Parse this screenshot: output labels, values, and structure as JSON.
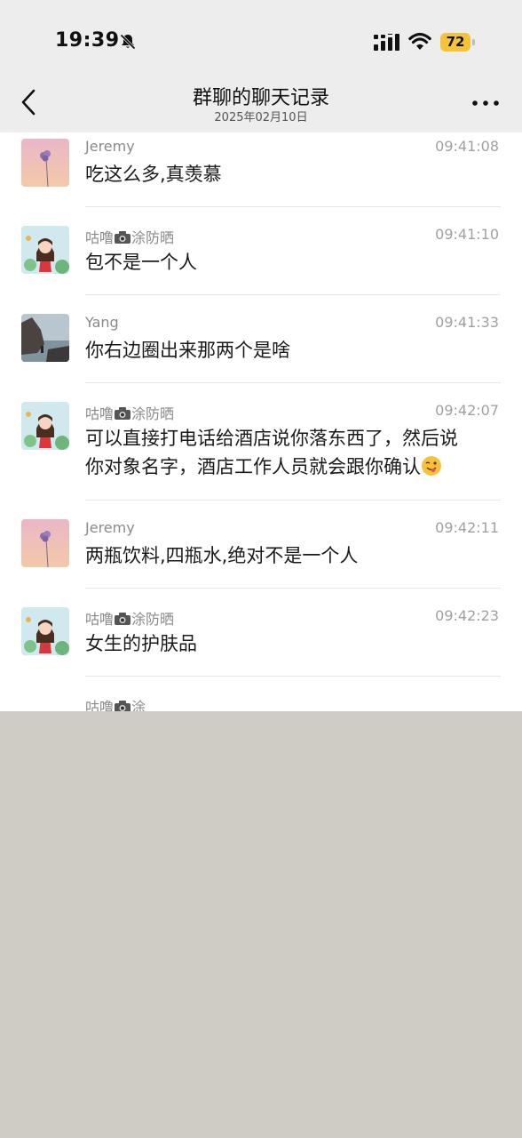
{
  "status_bar": {
    "time": "19:39",
    "battery": "72",
    "icons": [
      "bell-off-icon",
      "signal-icon",
      "wifi-icon",
      "battery-icon"
    ]
  },
  "header": {
    "title": "群聊的聊天记录",
    "subtitle": "2025年02月10日",
    "back_icon": "chevron-left-icon",
    "more_icon": "more-dots-icon"
  },
  "messages": [
    {
      "sender": "Jeremy",
      "time": "09:41:08",
      "text": "吃这么多,真羡慕",
      "avatar": "flower-avatar"
    },
    {
      "sender_prefix": "咕噜",
      "sender_suffix": "涂防晒",
      "time": "09:41:10",
      "text": "包不是一个人",
      "avatar": "girl-avatar"
    },
    {
      "sender": "Yang",
      "time": "09:41:33",
      "text": "你右边圈出来那两个是啥",
      "avatar": "seaside-avatar"
    },
    {
      "sender_prefix": "咕噜",
      "sender_suffix": "涂防晒",
      "time": "09:42:07",
      "text_line1": "可以直接打电话给酒店说你落东西了，然后说",
      "text_line2": "你对象名字，酒店工作人员就会跟你确认",
      "avatar": "girl-avatar"
    },
    {
      "sender": "Jeremy",
      "time": "09:42:11",
      "text": "两瓶饮料,四瓶水,绝对不是一个人",
      "avatar": "flower-avatar"
    },
    {
      "sender_prefix": "咕噜",
      "sender_suffix": "涂防晒",
      "time": "09:42:23",
      "text": "女生的护肤品",
      "avatar": "girl-avatar"
    },
    {
      "sender_prefix": "咕噜",
      "sender_suffix": "涂"
    }
  ],
  "colors": {
    "header_bg": "#ededed",
    "battery": "#f4c33a",
    "background_below": "#cfccc6"
  }
}
